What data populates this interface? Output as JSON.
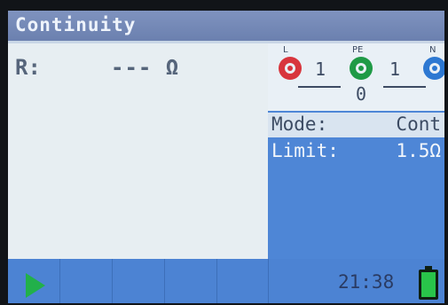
{
  "title": "Continuity",
  "measurement": {
    "label": "R:",
    "value": "--- Ω"
  },
  "terminals": {
    "l_label": "L",
    "pe_label": "PE",
    "n_label": "N",
    "l_pe_value": "1",
    "pe_n_value": "1",
    "pe_value": "0",
    "colors": {
      "l": "#d8353d",
      "pe": "#1f9a46",
      "n": "#2d78d2"
    }
  },
  "settings": {
    "mode_label": "Mode:",
    "mode_value": "Cont",
    "limit_label": "Limit:",
    "limit_value": "1.5Ω"
  },
  "statusbar": {
    "time": "21:38",
    "play_icon": "play-icon",
    "battery_icon": "battery-icon"
  }
}
